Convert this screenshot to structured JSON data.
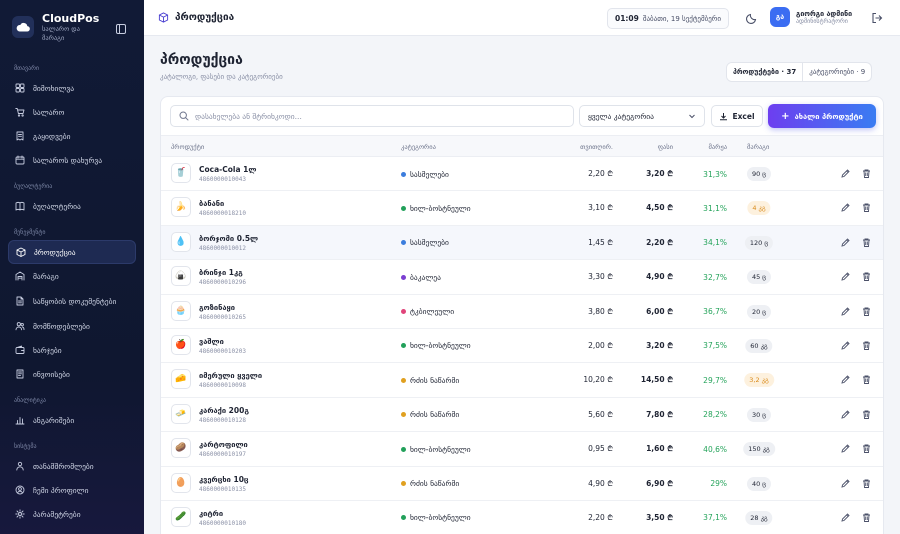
{
  "brand": {
    "name": "CloudPos",
    "subtitle": "სალარო და მარაგი"
  },
  "sidebar": {
    "sections": [
      {
        "title": "მთავარი",
        "items": [
          {
            "label": "მიმოხილვა",
            "icon": "dashboard-icon"
          },
          {
            "label": "სალარო",
            "icon": "cart-icon"
          },
          {
            "label": "გაყიდვები",
            "icon": "receipt-icon"
          },
          {
            "label": "სალაროს დახურვა",
            "icon": "calendar-icon"
          }
        ]
      },
      {
        "title": "ბუღალტერია",
        "items": [
          {
            "label": "ბუღალტერია",
            "icon": "book-icon"
          }
        ]
      },
      {
        "title": "მენეჯმენტი",
        "items": [
          {
            "label": "პროდუქცია",
            "icon": "box-icon",
            "active": true
          },
          {
            "label": "მარაგი",
            "icon": "warehouse-icon"
          },
          {
            "label": "საწყობის დოკუმენტები",
            "icon": "document-icon"
          },
          {
            "label": "მომწოდებლები",
            "icon": "users-icon"
          },
          {
            "label": "ხარჯები",
            "icon": "wallet-icon"
          },
          {
            "label": "ინვოისები",
            "icon": "invoice-icon"
          }
        ]
      },
      {
        "title": "ანალიტიკა",
        "items": [
          {
            "label": "ანგარიშები",
            "icon": "chart-icon"
          }
        ]
      },
      {
        "title": "სისტემა",
        "items": [
          {
            "label": "თანამშრომლები",
            "icon": "team-icon"
          },
          {
            "label": "ჩემი პროფილი",
            "icon": "profile-icon"
          },
          {
            "label": "პარამეტრები",
            "icon": "gear-icon"
          }
        ]
      }
    ]
  },
  "header": {
    "title": "პროდუქცია",
    "time": "01:09",
    "date": "შაბათი, 19 სექტემბერი",
    "user_initials": "გა",
    "user_name": "გიორგი ადმინი",
    "user_role": "ადმინისტრატორი"
  },
  "page": {
    "title": "პროდუქცია",
    "subtitle": "კატალოგი, ფასები და კატეგორიები",
    "count_products": "პროდუქტები · 37",
    "count_categories": "კატეგორიები · 9"
  },
  "toolbar": {
    "search_placeholder": "დასახელება ან შტრიხკოდი...",
    "category_select": "ყველა კატეგორია",
    "excel_label": "Excel",
    "add_label": "ახალი პროდუქტი"
  },
  "table": {
    "headers": {
      "product": "პროდუქტი",
      "category": "კატეგორია",
      "cost": "თვითღირ.",
      "price": "ფასი",
      "margin": "მარჟა",
      "stock": "მარაგი"
    },
    "rows": [
      {
        "name": "Coca-Cola 1ლ",
        "sku": "4860000010043",
        "emoji": "🥤",
        "category": "სასმელები",
        "cat_color": "#3b7ddd",
        "cost": "2,20 ₾",
        "price": "3,20 ₾",
        "margin": "31,3%",
        "stock": "90 ც",
        "low": false,
        "hl": false
      },
      {
        "name": "ბანანი",
        "sku": "4860000018210",
        "emoji": "🍌",
        "category": "ხილ-ბოსტნეული",
        "cat_color": "#22a05a",
        "cost": "3,10 ₾",
        "price": "4,50 ₾",
        "margin": "31,1%",
        "stock": "4 კგ",
        "low": true,
        "hl": false
      },
      {
        "name": "ბორჯომი 0.5ლ",
        "sku": "4860000010012",
        "emoji": "💧",
        "category": "სასმელები",
        "cat_color": "#3b7ddd",
        "cost": "1,45 ₾",
        "price": "2,20 ₾",
        "margin": "34,1%",
        "stock": "120 ც",
        "low": false,
        "hl": true
      },
      {
        "name": "ბრინჯი 1კგ",
        "sku": "4860000010296",
        "emoji": "🍙",
        "category": "ბაკალეა",
        "cat_color": "#7b3fd1",
        "cost": "3,30 ₾",
        "price": "4,90 ₾",
        "margin": "32,7%",
        "stock": "45 ც",
        "low": false,
        "hl": false
      },
      {
        "name": "გოზინაყი",
        "sku": "4860000010265",
        "emoji": "🧁",
        "category": "ტკბილეული",
        "cat_color": "#e0447a",
        "cost": "3,80 ₾",
        "price": "6,00 ₾",
        "margin": "36,7%",
        "stock": "20 ც",
        "low": false,
        "hl": false
      },
      {
        "name": "ვაშლი",
        "sku": "4860000010203",
        "emoji": "🍎",
        "category": "ხილ-ბოსტნეული",
        "cat_color": "#22a05a",
        "cost": "2,00 ₾",
        "price": "3,20 ₾",
        "margin": "37,5%",
        "stock": "60 კგ",
        "low": false,
        "hl": false
      },
      {
        "name": "იმერული ყველი",
        "sku": "4860000010098",
        "emoji": "🧀",
        "category": "რძის ნაწარმი",
        "cat_color": "#e0a020",
        "cost": "10,20 ₾",
        "price": "14,50 ₾",
        "margin": "29,7%",
        "stock": "3,2 კგ",
        "low": true,
        "hl": false
      },
      {
        "name": "კარაქი 200გ",
        "sku": "4860000010128",
        "emoji": "🧈",
        "category": "რძის ნაწარმი",
        "cat_color": "#e0a020",
        "cost": "5,60 ₾",
        "price": "7,80 ₾",
        "margin": "28,2%",
        "stock": "30 ც",
        "low": false,
        "hl": false
      },
      {
        "name": "კარტოფილი",
        "sku": "4860000010197",
        "emoji": "🥔",
        "category": "ხილ-ბოსტნეული",
        "cat_color": "#22a05a",
        "cost": "0,95 ₾",
        "price": "1,60 ₾",
        "margin": "40,6%",
        "stock": "150 კგ",
        "low": false,
        "hl": false
      },
      {
        "name": "კვერცხი 10ც",
        "sku": "4860000010135",
        "emoji": "🥚",
        "category": "რძის ნაწარმი",
        "cat_color": "#e0a020",
        "cost": "4,90 ₾",
        "price": "6,90 ₾",
        "margin": "29%",
        "stock": "40 ც",
        "low": false,
        "hl": false
      },
      {
        "name": "კიტრი",
        "sku": "4860000010180",
        "emoji": "🥒",
        "category": "ხილ-ბოსტნეული",
        "cat_color": "#22a05a",
        "cost": "2,20 ₾",
        "price": "3,50 ₾",
        "margin": "37,1%",
        "stock": "28 კგ",
        "low": false,
        "hl": false
      }
    ]
  }
}
